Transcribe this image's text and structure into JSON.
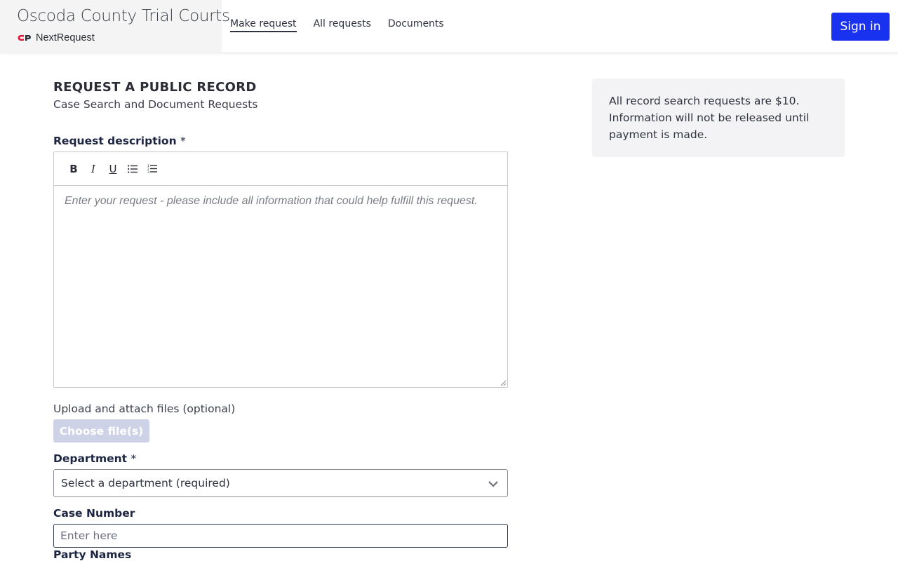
{
  "brand": {
    "title": "Oscoda County Trial Courts",
    "subtitle": "NextRequest",
    "logo_color": "#e21b3c"
  },
  "nav": {
    "items": [
      {
        "label": "Make request",
        "active": true
      },
      {
        "label": "All requests",
        "active": false
      },
      {
        "label": "Documents",
        "active": false
      }
    ]
  },
  "header": {
    "signin_label": "Sign in",
    "signin_color": "#1932f0"
  },
  "form": {
    "heading": "REQUEST A PUBLIC RECORD",
    "subheading": "Case Search and Document Requests",
    "description": {
      "label": "Request description",
      "required_mark": "*",
      "toolbar": [
        "bold-icon",
        "italic-icon",
        "underline-icon",
        "bullet-list-icon",
        "numbered-list-icon"
      ],
      "toolbar_glyphs": {
        "bold": "B",
        "italic": "I",
        "underline": "U"
      },
      "placeholder": "Enter your request - please include all information that could help fulfill this request."
    },
    "upload": {
      "label": "Upload and attach files (optional)",
      "button_label": "Choose file(s)"
    },
    "department": {
      "label": "Department",
      "required_mark": "*",
      "selected": "Select a department (required)"
    },
    "case_number": {
      "label": "Case Number",
      "placeholder": "Enter here"
    },
    "party_names": {
      "label": "Party Names"
    }
  },
  "notice": {
    "text": "All record search requests are $10. Information will not be released until payment is made."
  }
}
